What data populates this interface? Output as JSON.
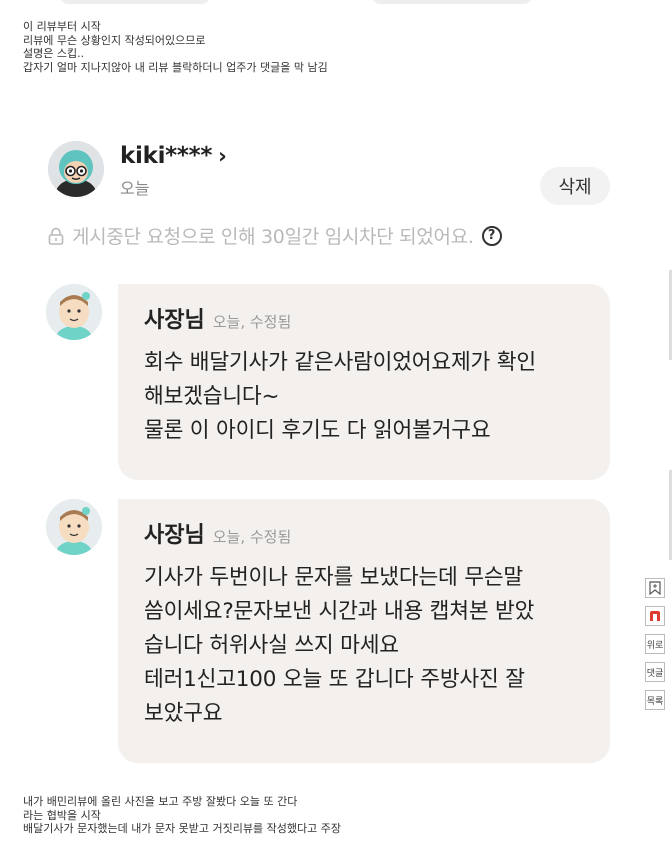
{
  "notes_top": [
    "이 리뷰부터 시작",
    "리뷰에 무슨 상황인지 작성되어있으므로",
    "설명은 스킵..",
    "갑자기 얼마 지나지않아 내 리뷰 블락하더니 업주가 댓글을 막 남김"
  ],
  "review": {
    "username": "kiki****",
    "date": "오늘",
    "delete_label": "삭제",
    "blocked_notice": "게시중단 요청으로 인해 30일간 임시차단 되었어요.",
    "help_glyph": "?"
  },
  "replies": [
    {
      "name": "사장님",
      "meta": "오늘, 수정됨",
      "lines": [
        "회수 배달기사가 같은사람이었어요제가 확인",
        "해보겠습니다~",
        "물론 이 아이디 후기도 다 읽어볼거구요"
      ]
    },
    {
      "name": "사장님",
      "meta": "오늘, 수정됨",
      "lines": [
        "기사가 두번이나 문자를 보냈다는데 무슨말",
        "씀이세요?문자보낸 시간과 내용 캡쳐본 받았",
        "습니다 허위사실 쓰지 마세요",
        "테러1신고100 오늘 또 갑니다 주방사진 잘",
        "보았구요"
      ]
    }
  ],
  "notes_bottom": [
    "내가 배민리뷰에 올린 사진을 보고 주방 잘봤다 오늘 또 간다",
    "라는 협박을 시작",
    "배달기사가 문자했는데 내가 문자 못받고 거짓리뷰를 작성했다고 주장"
  ],
  "side_tools": [
    "",
    "",
    "위로",
    "댓글",
    "목록"
  ],
  "colors": {
    "bubble": "#f4f0ed",
    "muted": "#b9b9b9",
    "accent_red": "#e03b2f"
  }
}
